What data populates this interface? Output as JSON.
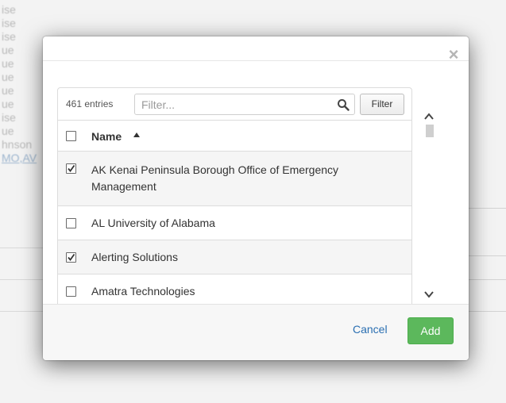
{
  "background": {
    "lines": [
      "ise",
      "ise",
      "ise",
      "ue",
      "ue",
      "ue",
      "ue",
      "ue",
      "ise",
      "ue",
      "hnson"
    ],
    "link": "MO,AV"
  },
  "modal": {
    "close_label": "×",
    "table": {
      "entries_label": "461 entries",
      "search_placeholder": "Filter...",
      "search_value": "",
      "filter_button": "Filter",
      "column_name": "Name",
      "rows": [
        {
          "label": "AK Kenai Peninsula Borough Office of Emergency Management",
          "checked": true
        },
        {
          "label": "AL University of Alabama",
          "checked": false
        },
        {
          "label": "Alerting Solutions",
          "checked": true
        },
        {
          "label": "Amatra Technologies",
          "checked": false
        }
      ]
    },
    "footer": {
      "cancel_label": "Cancel",
      "add_label": "Add"
    }
  },
  "colors": {
    "add_button": "#5cb85c",
    "cancel_link": "#2a6fb2"
  }
}
